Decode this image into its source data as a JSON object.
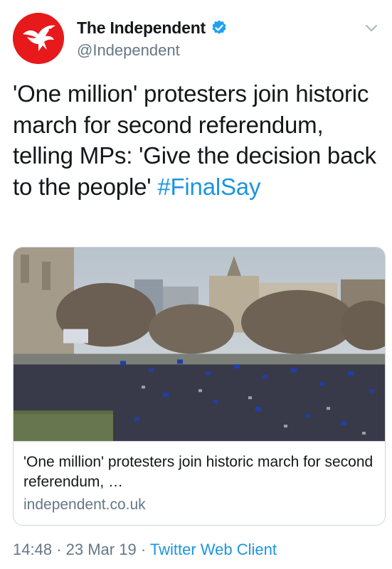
{
  "account": {
    "display_name": "The Independent",
    "handle": "@Independent",
    "verified": true,
    "avatar_icon": "independent-eagle-logo",
    "avatar_color": "#e8191b"
  },
  "tweet": {
    "text": "'One million' protesters join historic march for second referendum, telling MPs: 'Give the decision back to the people'",
    "hashtag": "#FinalSay"
  },
  "link_card": {
    "image_icon": "protest-crowd-photo",
    "title": "'One million' protesters join historic march for second referendum, …",
    "domain": "independent.co.uk"
  },
  "meta": {
    "time": "14:48",
    "separator": "·",
    "date": "23 Mar 19",
    "client": "Twitter Web Client"
  },
  "colors": {
    "link": "#1b95e0",
    "secondary_text": "#657786",
    "border": "#ccd6dd"
  }
}
